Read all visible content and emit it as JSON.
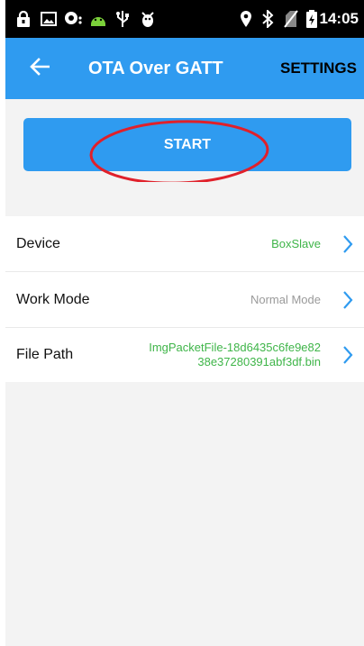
{
  "status_bar": {
    "time": "14:05",
    "icons": [
      "lock-icon",
      "image-icon",
      "chat-icon",
      "android-icon",
      "usb-icon",
      "debug-icon",
      "location-icon",
      "bluetooth-icon",
      "no-sim-icon",
      "battery-icon"
    ]
  },
  "app_bar": {
    "title": "OTA Over GATT",
    "settings_label": "SETTINGS",
    "back_icon": "arrow-left-icon"
  },
  "start_button": {
    "label": "START"
  },
  "list": [
    {
      "label": "Device",
      "value": "BoxSlave"
    },
    {
      "label": "Work Mode",
      "value": "Normal Mode"
    },
    {
      "label": "File Path",
      "value_line1": "ImgPacketFile-18d6435c6fe9e82",
      "value_line2": "38e37280391abf3df.bin"
    }
  ],
  "colors": {
    "accent": "#2f9bf0",
    "value_green": "#3fb549",
    "value_grey": "#9a9a9a",
    "annotation_red": "#e0202a"
  }
}
